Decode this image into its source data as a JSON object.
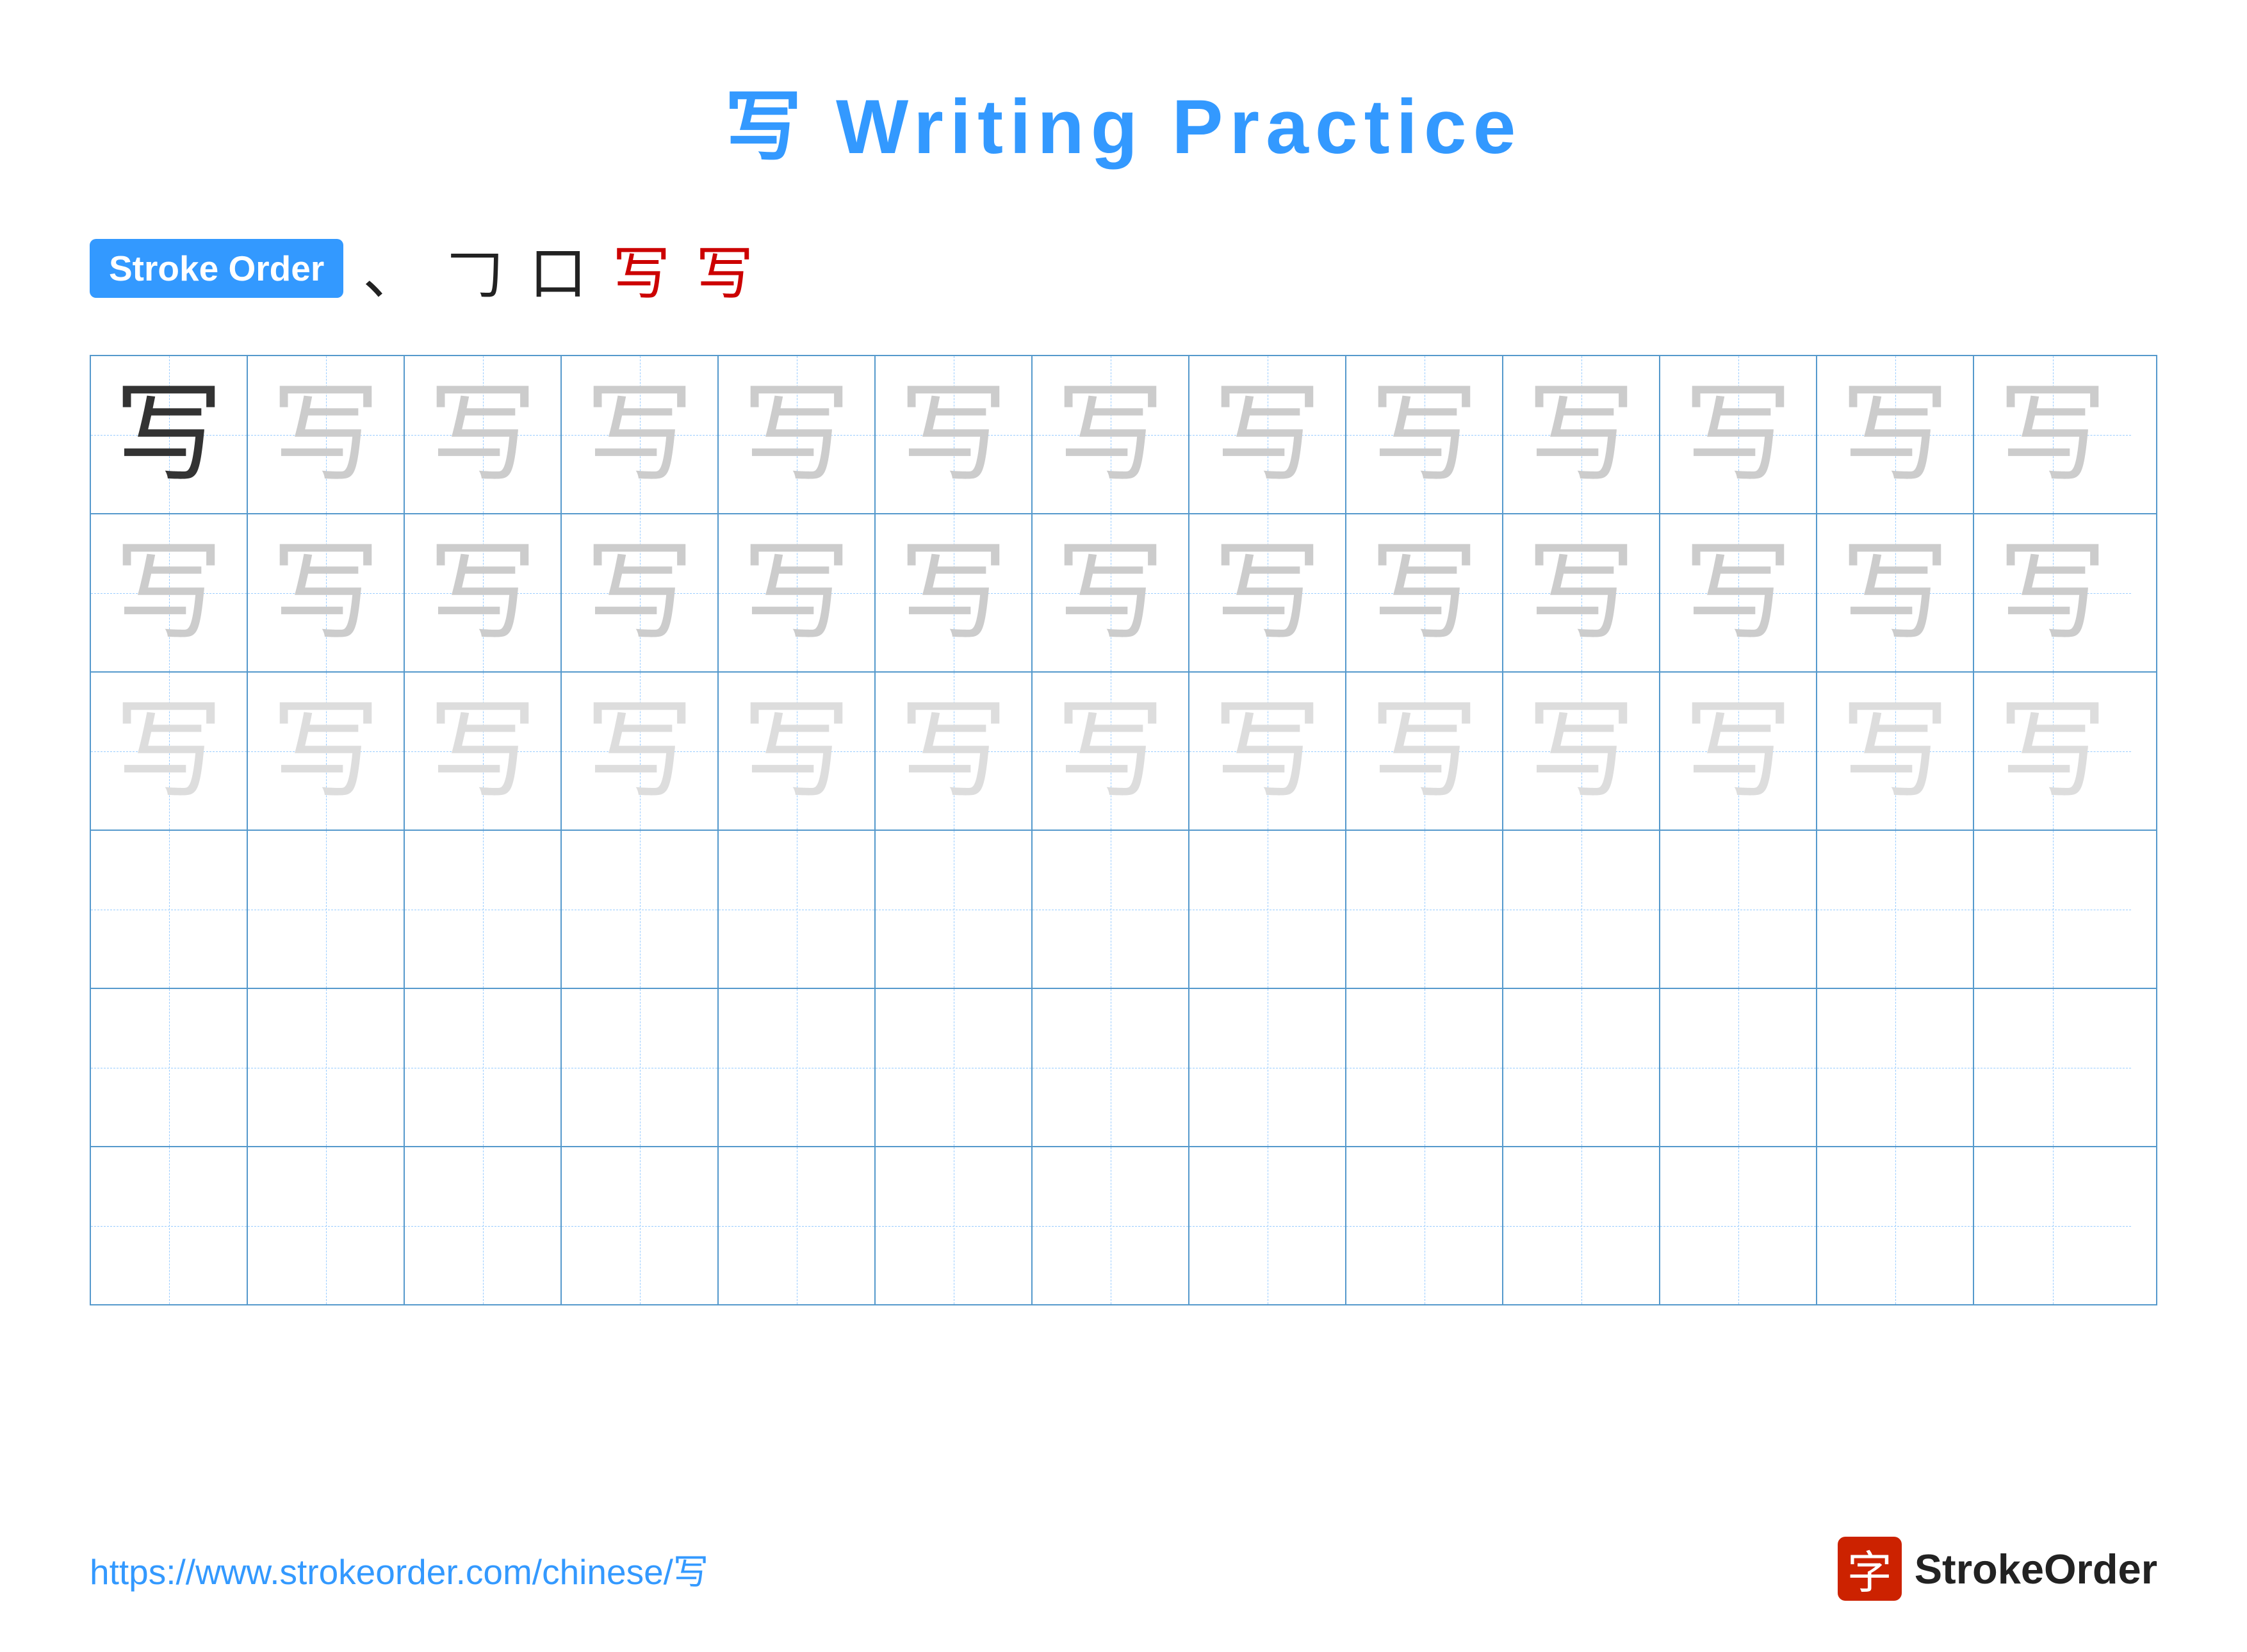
{
  "header": {
    "title": "写 Writing Practice"
  },
  "stroke_order": {
    "badge_label": "Stroke Order",
    "strokes": [
      "、",
      "𠃌",
      "口",
      "写",
      "写"
    ]
  },
  "grid": {
    "rows": 6,
    "cols": 13,
    "character": "写",
    "row_configs": [
      {
        "type": "dark_then_light",
        "dark_count": 1
      },
      {
        "type": "all_light"
      },
      {
        "type": "all_lighter"
      },
      {
        "type": "empty"
      },
      {
        "type": "empty"
      },
      {
        "type": "empty"
      }
    ]
  },
  "footer": {
    "url": "https://www.strokeorder.com/chinese/写",
    "logo_char": "字",
    "logo_label": "StrokeOrder"
  }
}
